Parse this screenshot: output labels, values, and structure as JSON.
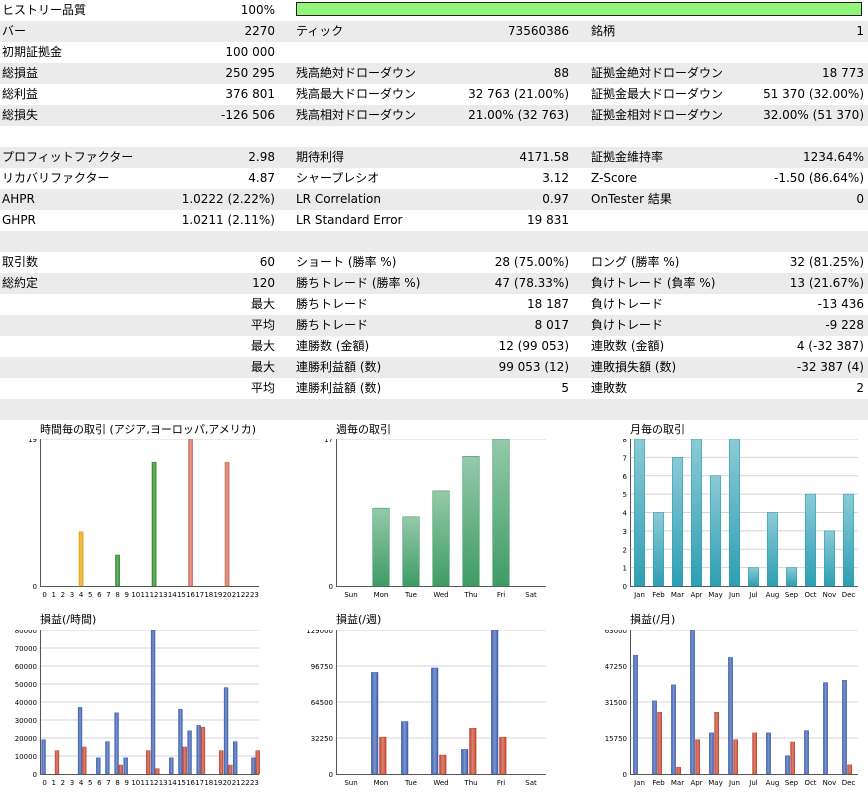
{
  "stats": [
    {
      "label": "ヒストリー品質",
      "value": "100%",
      "quality_fraction": 1.0
    },
    {
      "label": "バー",
      "value": "2270",
      "label2": "ティック",
      "value2": "73560386",
      "label3": "銘柄",
      "value3": "1"
    },
    {
      "label": "初期証拠金",
      "value": "100 000"
    },
    {
      "label": "総損益",
      "value": "250 295",
      "label2": "残高絶対ドローダウン",
      "value2": "88",
      "label3": "証拠金絶対ドローダウン",
      "value3": "18 773"
    },
    {
      "label": "総利益",
      "value": "376 801",
      "label2": "残高最大ドローダウン",
      "value2": "32 763 (21.00%)",
      "label3": "証拠金最大ドローダウン",
      "value3": "51 370 (32.00%)"
    },
    {
      "label": "総損失",
      "value": "-126 506",
      "label2": "残高相対ドローダウン",
      "value2": "21.00% (32 763)",
      "label3": "証拠金相対ドローダウン",
      "value3": "32.00% (51 370)"
    },
    {},
    {
      "label": "プロフィットファクター",
      "value": "2.98",
      "label2": "期待利得",
      "value2": "4171.58",
      "label3": "証拠金維持率",
      "value3": "1234.64%"
    },
    {
      "label": "リカバリファクター",
      "value": "4.87",
      "label2": "シャープレシオ",
      "value2": "3.12",
      "label3": "Z-Score",
      "value3": "-1.50 (86.64%)"
    },
    {
      "label": "AHPR",
      "value": "1.0222 (2.22%)",
      "label2": "LR Correlation",
      "value2": "0.97",
      "label3": "OnTester 結果",
      "value3": "0"
    },
    {
      "label": "GHPR",
      "value": "1.0211 (2.11%)",
      "label2": "LR Standard Error",
      "value2": "19 831"
    },
    {},
    {
      "label": "取引数",
      "value": "60",
      "label2": "ショート (勝率 %)",
      "value2": "28 (75.00%)",
      "label3": "ロング (勝率 %)",
      "value3": "32 (81.25%)"
    },
    {
      "label": "総約定",
      "value": "120",
      "label2": "勝ちトレード (勝率 %)",
      "value2": "47 (78.33%)",
      "label3": "負けトレード (負率 %)",
      "value3": "13 (21.67%)"
    },
    {
      "value": "最大",
      "label2": "勝ちトレード",
      "value2": "18 187",
      "label3": "負けトレード",
      "value3": "-13 436"
    },
    {
      "value": "平均",
      "label2": "勝ちトレード",
      "value2": "8 017",
      "label3": "負けトレード",
      "value3": "-9 228"
    },
    {
      "value": "最大",
      "label2": "連勝数 (金額)",
      "value2": "12 (99 053)",
      "label3": "連敗数 (金額)",
      "value3": "4 (-32 387)"
    },
    {
      "value": "最大",
      "label2": "連勝利益額 (数)",
      "value2": "99 053 (12)",
      "label3": "連敗損失額 (数)",
      "value3": "-32 387 (4)"
    },
    {
      "value": "平均",
      "label2": "連勝利益額 (数)",
      "value2": "5",
      "label3": "連敗数",
      "value3": "2"
    },
    {}
  ],
  "chart_data": [
    {
      "type": "bar",
      "title": "時間毎の取引 (アジア,ヨーロッパ,アメリカ)",
      "categories": [
        "0",
        "1",
        "2",
        "3",
        "4",
        "5",
        "6",
        "7",
        "8",
        "9",
        "10",
        "11",
        "12",
        "13",
        "14",
        "15",
        "16",
        "17",
        "18",
        "19",
        "20",
        "21",
        "22",
        "23"
      ],
      "values": [
        0,
        0,
        0,
        0,
        7,
        0,
        0,
        0,
        4,
        0,
        0,
        0,
        16,
        0,
        0,
        0,
        19,
        0,
        0,
        0,
        16,
        0,
        0,
        0
      ],
      "ylim": [
        0,
        19
      ],
      "yticks": [
        "0",
        "19"
      ],
      "colors": [
        "#e7a20f",
        "#2a8a2a",
        "#d36b5a"
      ]
    },
    {
      "type": "bar",
      "title": "週毎の取引",
      "categories": [
        "Sun",
        "Mon",
        "Tue",
        "Wed",
        "Thu",
        "Fri",
        "Sat"
      ],
      "values": [
        0,
        9,
        8,
        11,
        15,
        17,
        0
      ],
      "ylim": [
        0,
        17
      ],
      "yticks": [
        "0",
        "17"
      ],
      "colors": [
        "#3e9c64"
      ]
    },
    {
      "type": "bar",
      "title": "月毎の取引",
      "categories": [
        "Jan",
        "Feb",
        "Mar",
        "Apr",
        "May",
        "Jun",
        "Jul",
        "Aug",
        "Sep",
        "Oct",
        "Nov",
        "Dec"
      ],
      "values": [
        8,
        4,
        7,
        8,
        6,
        8,
        1,
        4,
        1,
        5,
        3,
        5
      ],
      "ylim": [
        0,
        8
      ],
      "yticks": [
        "0",
        "1",
        "2",
        "3",
        "4",
        "5",
        "6",
        "7",
        "8"
      ],
      "colors": [
        "#2e9fb3"
      ]
    },
    {
      "type": "bar",
      "title": "損益(/時間)",
      "categories": [
        "0",
        "1",
        "2",
        "3",
        "4",
        "5",
        "6",
        "7",
        "8",
        "9",
        "10",
        "11",
        "12",
        "13",
        "14",
        "15",
        "16",
        "17",
        "18",
        "19",
        "20",
        "21",
        "22",
        "23"
      ],
      "series": [
        {
          "values": [
            19000,
            0,
            0,
            0,
            37000,
            0,
            9000,
            18000,
            34000,
            9000,
            0,
            0,
            80000,
            0,
            9000,
            36000,
            24000,
            27000,
            0,
            0,
            48000,
            18000,
            0,
            9000
          ]
        },
        {
          "values": [
            0,
            13000,
            0,
            0,
            15000,
            0,
            0,
            0,
            5000,
            0,
            0,
            13000,
            3000,
            0,
            0,
            15000,
            0,
            26000,
            0,
            13000,
            5000,
            0,
            0,
            13000
          ]
        }
      ],
      "ylim": [
        0,
        80000
      ],
      "yticks": [
        "0",
        "10000",
        "20000",
        "30000",
        "40000",
        "50000",
        "60000",
        "70000",
        "80000"
      ],
      "colors": [
        "#3b5eb0",
        "#c5432c"
      ]
    },
    {
      "type": "bar",
      "title": "損益(/週)",
      "categories": [
        "Sun",
        "Mon",
        "Tue",
        "Wed",
        "Thu",
        "Fri",
        "Sat"
      ],
      "series": [
        {
          "values": [
            0,
            91000,
            47000,
            95000,
            22000,
            129000,
            0
          ]
        },
        {
          "values": [
            0,
            33000,
            0,
            17000,
            41000,
            33000,
            0
          ]
        }
      ],
      "ylim": [
        0,
        129000
      ],
      "yticks": [
        "0",
        "32250",
        "64500",
        "96750",
        "129000"
      ],
      "colors": [
        "#3b5eb0",
        "#c5432c"
      ]
    },
    {
      "type": "bar",
      "title": "損益(/月)",
      "categories": [
        "Jan",
        "Feb",
        "Mar",
        "Apr",
        "May",
        "Jun",
        "Jul",
        "Aug",
        "Sep",
        "Oct",
        "Nov",
        "Dec"
      ],
      "series": [
        {
          "values": [
            52000,
            32000,
            39000,
            63000,
            18000,
            51000,
            0,
            18000,
            8000,
            19000,
            40000,
            41000
          ]
        },
        {
          "values": [
            0,
            27000,
            3000,
            15000,
            27000,
            15000,
            18000,
            0,
            14000,
            0,
            0,
            4000
          ]
        }
      ],
      "ylim": [
        0,
        63000
      ],
      "yticks": [
        "0",
        "15750",
        "31500",
        "47250",
        "63000"
      ],
      "colors": [
        "#3b5eb0",
        "#c5432c"
      ]
    }
  ]
}
